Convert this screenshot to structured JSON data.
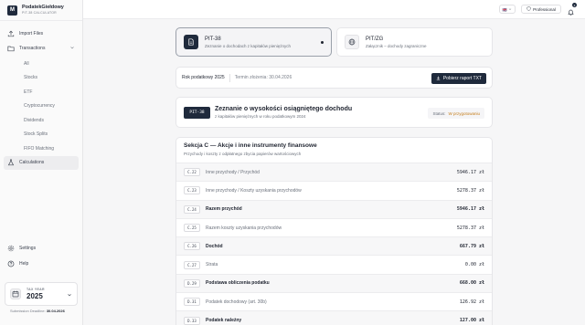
{
  "brand": {
    "name": "PodatekGiełdowy",
    "subtitle": "PIT-38 CALCULATOR",
    "logo_letter": "M"
  },
  "sidebar": {
    "items": [
      {
        "label": "Import Files",
        "icon": "upload-icon"
      },
      {
        "label": "Transactions",
        "icon": "folder-icon"
      }
    ],
    "sub_items": [
      "All",
      "Stocks",
      "ETF",
      "Cryptocurrency",
      "Dividends",
      "Stock Splits",
      "FIFO Matching"
    ],
    "calculations": "Calculations",
    "settings": "Settings",
    "help": "Help",
    "tax_year_label": "TAX YEAR",
    "tax_year": "2025",
    "deadline_label": "Submission Deadline:",
    "deadline_value": "30.04.2026"
  },
  "topbar": {
    "language": "🇬🇧",
    "plan": "Professional",
    "notifications": "3"
  },
  "forms": [
    {
      "title": "PIT-38",
      "subtitle": "Zeznanie o dochodach z kapitałów pieniężnych"
    },
    {
      "title": "PIT/ZG",
      "subtitle": "Załącznik – dochody zagraniczne"
    }
  ],
  "yearbar": {
    "year_label": "Rok podatkowy 2025",
    "deadline": "Termin złożenia: 30.04.2026",
    "download": "Pobierz raport TXT"
  },
  "declaration": {
    "badge": "PIT-38",
    "title": "Zeznanie o wysokości osiągniętego dochodu",
    "subtitle": "z kapitałów pieniężnych w roku podatkowym 2024",
    "status_label": "Status:",
    "status_value": "W przygotowaniu"
  },
  "section": {
    "title": "Sekcja C — Akcje i inne instrumenty finansowe",
    "subtitle": "Przychody i koszty z odpłatnego zbycia papierów wartościowych",
    "rows": [
      {
        "code": "C.22",
        "label": "Inne przychody / Przychód",
        "value": "5946.17 zł",
        "bold": false
      },
      {
        "code": "C.23",
        "label": "Inne przychody / Koszty uzyskania przychodów",
        "value": "5278.37 zł",
        "bold": false
      },
      {
        "code": "C.24",
        "label": "Razem przychód",
        "value": "5946.17 zł",
        "bold": true
      },
      {
        "code": "C.25",
        "label": "Razem koszty uzyskania przychodów",
        "value": "5278.37 zł",
        "bold": false
      },
      {
        "code": "C.26",
        "label": "Dochód",
        "value": "667.79 zł",
        "bold": true
      },
      {
        "code": "C.27",
        "label": "Strata",
        "value": "0.00 zł",
        "bold": false
      },
      {
        "code": "D.29",
        "label": "Podstawa obliczenia podatku",
        "value": "668.00 zł",
        "bold": true
      },
      {
        "code": "D.31",
        "label": "Podatek dochodowy (art. 30b)",
        "value": "126.92 zł",
        "bold": false
      },
      {
        "code": "D.33",
        "label": "Podatek należny",
        "value": "127.00 zł",
        "bold": true
      }
    ]
  }
}
